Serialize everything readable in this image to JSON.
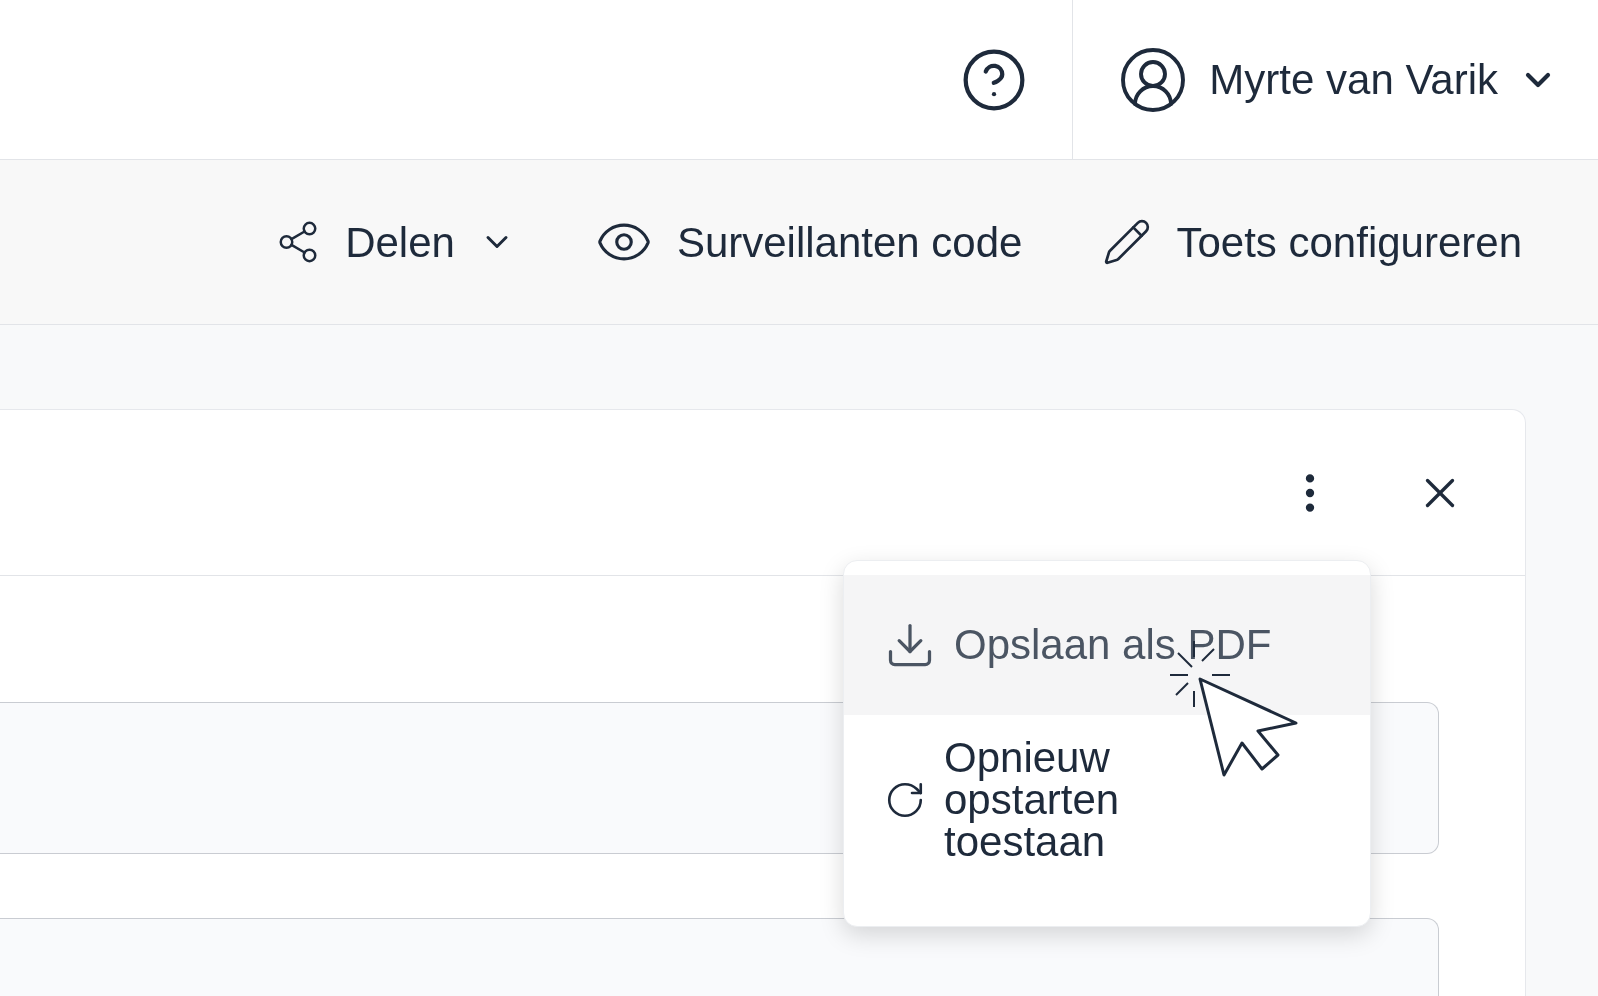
{
  "header": {
    "user_name": "Myrte van Varik"
  },
  "toolbar": {
    "actions": [
      {
        "label": "Delen",
        "kind": "share",
        "dropdown": true
      },
      {
        "label": "Surveillanten code",
        "kind": "eye",
        "dropdown": false
      },
      {
        "label": "Toets configureren",
        "kind": "edit",
        "dropdown": false
      }
    ]
  },
  "menu": {
    "items": [
      {
        "label": "Opslaan als PDF",
        "kind": "download",
        "selected": true
      },
      {
        "label": "Opnieuw opstarten toestaan",
        "kind": "restart",
        "selected": false
      }
    ]
  }
}
